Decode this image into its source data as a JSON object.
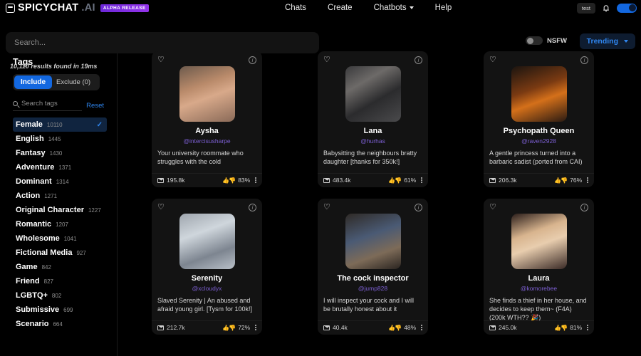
{
  "brand": {
    "name": "SPICYCHAT",
    "suffix": ".AI",
    "badge": "ALPHA RELEASE"
  },
  "nav": {
    "links": [
      {
        "label": "Chats",
        "has_caret": false
      },
      {
        "label": "Create",
        "has_caret": false
      },
      {
        "label": "Chatbots",
        "has_caret": true
      },
      {
        "label": "Help",
        "has_caret": false
      }
    ],
    "user_chip": "test"
  },
  "search": {
    "placeholder": "Search...",
    "value": "",
    "nsfw_label": "NSFW",
    "nsfw_on": false,
    "sort_label": "Trending",
    "results_text": "10,110 results found in 19ms"
  },
  "sidebar": {
    "title": "Tags",
    "include_label": "Include",
    "exclude_label": "Exclude (0)",
    "tag_search_placeholder": "Search tags",
    "reset_label": "Reset",
    "tags": [
      {
        "label": "Female",
        "count": "10110",
        "selected": true
      },
      {
        "label": "English",
        "count": "1445",
        "selected": false
      },
      {
        "label": "Fantasy",
        "count": "1430",
        "selected": false
      },
      {
        "label": "Adventure",
        "count": "1371",
        "selected": false
      },
      {
        "label": "Dominant",
        "count": "1314",
        "selected": false
      },
      {
        "label": "Action",
        "count": "1271",
        "selected": false
      },
      {
        "label": "Original Character",
        "count": "1227",
        "selected": false
      },
      {
        "label": "Romantic",
        "count": "1207",
        "selected": false
      },
      {
        "label": "Wholesome",
        "count": "1041",
        "selected": false
      },
      {
        "label": "Fictional Media",
        "count": "927",
        "selected": false
      },
      {
        "label": "Game",
        "count": "842",
        "selected": false
      },
      {
        "label": "Friend",
        "count": "827",
        "selected": false
      },
      {
        "label": "LGBTQ+",
        "count": "802",
        "selected": false
      },
      {
        "label": "Submissive",
        "count": "699",
        "selected": false
      },
      {
        "label": "Scenario",
        "count": "664",
        "selected": false
      }
    ]
  },
  "cards": [
    {
      "name": "Aysha",
      "handle": "@intercisusharpe",
      "description": "Your university roommate who struggles with the cold",
      "messages": "195.8k",
      "rating": "83%"
    },
    {
      "name": "Lana",
      "handle": "@hurhas",
      "description": "Babysitting the neighbours bratty daughter [thanks for 350k!]",
      "messages": "483.4k",
      "rating": "61%"
    },
    {
      "name": "Psychopath Queen",
      "handle": "@raven2928",
      "description": "A gentle princess turned into a barbaric sadist (ported from CAI)",
      "messages": "206.3k",
      "rating": "76%"
    },
    {
      "name": "Serenity",
      "handle": "@xcloudyx",
      "description": "Slaved Serenity | An abused and afraid young girl. [Tysm for 100k!]",
      "messages": "212.7k",
      "rating": "72%"
    },
    {
      "name": "The cock inspector",
      "handle": "@jump828",
      "description": "I will inspect your cock and I will be brutally honest about it",
      "messages": "40.4k",
      "rating": "48%"
    },
    {
      "name": "Laura",
      "handle": "@komorebee",
      "description": "She finds a thief in her house, and decides to keep them~ (F4A) (200k WTH?? 🎉)",
      "messages": "245.0k",
      "rating": "81%"
    }
  ],
  "colors": {
    "accent_blue": "#1368e0",
    "link_blue": "#2f86f0",
    "handle_purple": "#7c5fd3",
    "badge_purple": "#9333ea",
    "card_bg": "#131313",
    "page_bg": "#000000"
  }
}
